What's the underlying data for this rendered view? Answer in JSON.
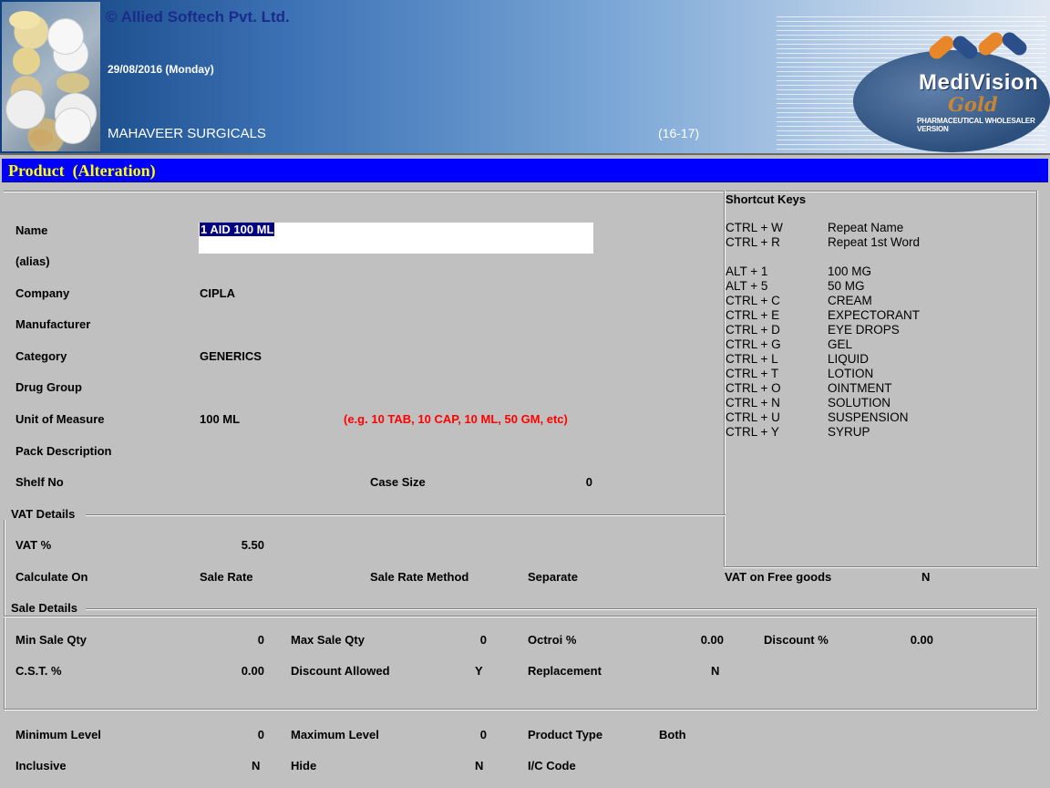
{
  "header": {
    "copyright": "© Allied Softech Pvt. Ltd.",
    "date": "29/08/2016 (Monday)",
    "company": "MAHAVEER SURGICALS",
    "financial_year": "(16-17)",
    "logo": {
      "name": "MediVision",
      "edition": "Gold",
      "tagline": "PHARMACEUTICAL WHOLESALER VERSION"
    }
  },
  "title_bar": {
    "title": "Product  (Alteration)",
    "color": "#0000ff",
    "text_color": "#ffff00"
  },
  "form": {
    "name": {
      "label": "Name",
      "value": "1 AID 100 ML"
    },
    "alias": {
      "label": "(alias)",
      "value": ""
    },
    "company": {
      "label": "Company",
      "value": "CIPLA"
    },
    "manufacturer": {
      "label": "Manufacturer",
      "value": ""
    },
    "category": {
      "label": "Category",
      "value": "GENERICS"
    },
    "drug_group": {
      "label": "Drug Group",
      "value": ""
    },
    "unit_of_measure": {
      "label": "Unit of Measure",
      "value": "100 ML",
      "hint": "(e.g. 10 TAB, 10 CAP, 10 ML, 50 GM, etc)"
    },
    "pack_description": {
      "label": "Pack Description",
      "value": ""
    },
    "shelf_no": {
      "label": "Shelf No",
      "value": ""
    },
    "case_size": {
      "label": "Case Size",
      "value": "0"
    }
  },
  "vat_details": {
    "section_title": "VAT Details",
    "vat_percent": {
      "label": "VAT %",
      "value": "5.50"
    },
    "calculate_on": {
      "label": "Calculate On",
      "value": "Sale Rate"
    },
    "sale_rate_method": {
      "label": "Sale Rate Method",
      "value": "Separate"
    },
    "vat_on_free_goods": {
      "label": "VAT on Free goods",
      "value": "N"
    }
  },
  "sale_details": {
    "section_title": "Sale Details",
    "min_sale_qty": {
      "label": "Min Sale Qty",
      "value": "0"
    },
    "max_sale_qty": {
      "label": "Max Sale Qty",
      "value": "0"
    },
    "octroi": {
      "label": "Octroi %",
      "value": "0.00"
    },
    "discount": {
      "label": "Discount %",
      "value": "0.00"
    },
    "cst": {
      "label": "C.S.T. %",
      "value": "0.00"
    },
    "discount_allowed": {
      "label": "Discount Allowed",
      "value": "Y"
    },
    "replacement": {
      "label": "Replacement",
      "value": "N"
    }
  },
  "stock": {
    "minimum_level": {
      "label": "Minimum Level",
      "value": "0"
    },
    "maximum_level": {
      "label": "Maximum Level",
      "value": "0"
    },
    "product_type": {
      "label": "Product Type",
      "value": "Both"
    },
    "inclusive": {
      "label": "Inclusive",
      "value": "N"
    },
    "hide": {
      "label": "Hide",
      "value": "N"
    },
    "ic_code": {
      "label": "I/C Code",
      "value": ""
    }
  },
  "shortcut_keys": {
    "title": "Shortcut Keys",
    "group1": [
      {
        "key": "CTRL + W",
        "action": "Repeat Name"
      },
      {
        "key": "CTRL + R",
        "action": "Repeat 1st Word"
      }
    ],
    "group2": [
      {
        "key": "ALT + 1",
        "action": "100 MG"
      },
      {
        "key": "ALT + 5",
        "action": "50 MG"
      },
      {
        "key": "CTRL + C",
        "action": "CREAM"
      },
      {
        "key": "CTRL + E",
        "action": "EXPECTORANT"
      },
      {
        "key": "CTRL + D",
        "action": "EYE DROPS"
      },
      {
        "key": "CTRL + G",
        "action": "GEL"
      },
      {
        "key": "CTRL + L",
        "action": "LIQUID"
      },
      {
        "key": "CTRL + T",
        "action": "LOTION"
      },
      {
        "key": "CTRL + O",
        "action": "OINTMENT"
      },
      {
        "key": "CTRL + N",
        "action": "SOLUTION"
      },
      {
        "key": "CTRL + U",
        "action": "SUSPENSION"
      },
      {
        "key": "CTRL + Y",
        "action": "SYRUP"
      }
    ]
  }
}
